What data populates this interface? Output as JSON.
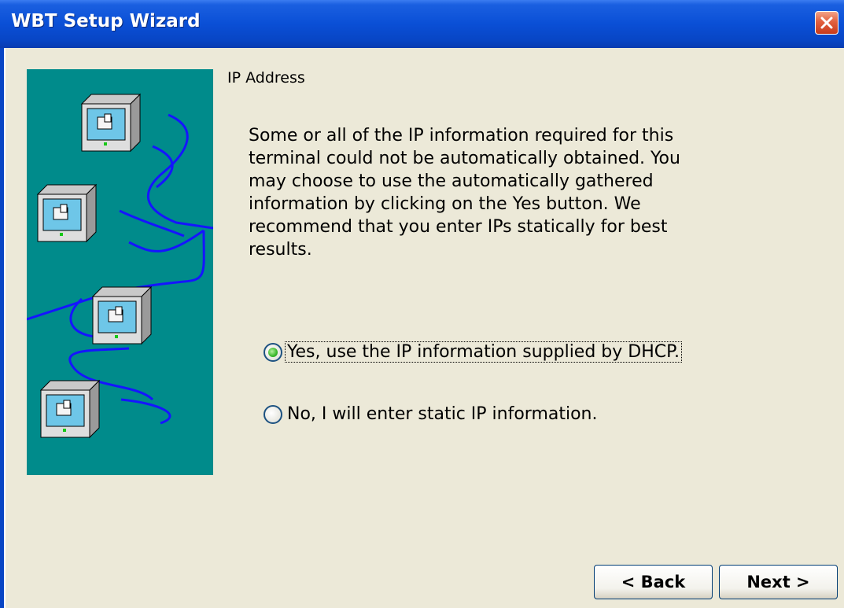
{
  "window": {
    "title": "WBT Setup Wizard"
  },
  "page": {
    "heading": "IP Address",
    "description": "Some or all of the IP information required for this terminal could not be automatically obtained. You may choose to use the automatically gathered information by clicking on the Yes button.  We recommend that you enter IPs statically for best results."
  },
  "options": {
    "yes_label": "Yes, use the IP information supplied by DHCP.",
    "no_label": "No, I will enter static IP information.",
    "selected": "yes"
  },
  "buttons": {
    "back_label": "< Back",
    "next_label": "Next >"
  },
  "colors": {
    "title_bar": "#0a4fd6",
    "illustration_bg": "#008b8b",
    "network_line": "#1515ff",
    "dialog_bg": "#ece9d8"
  }
}
